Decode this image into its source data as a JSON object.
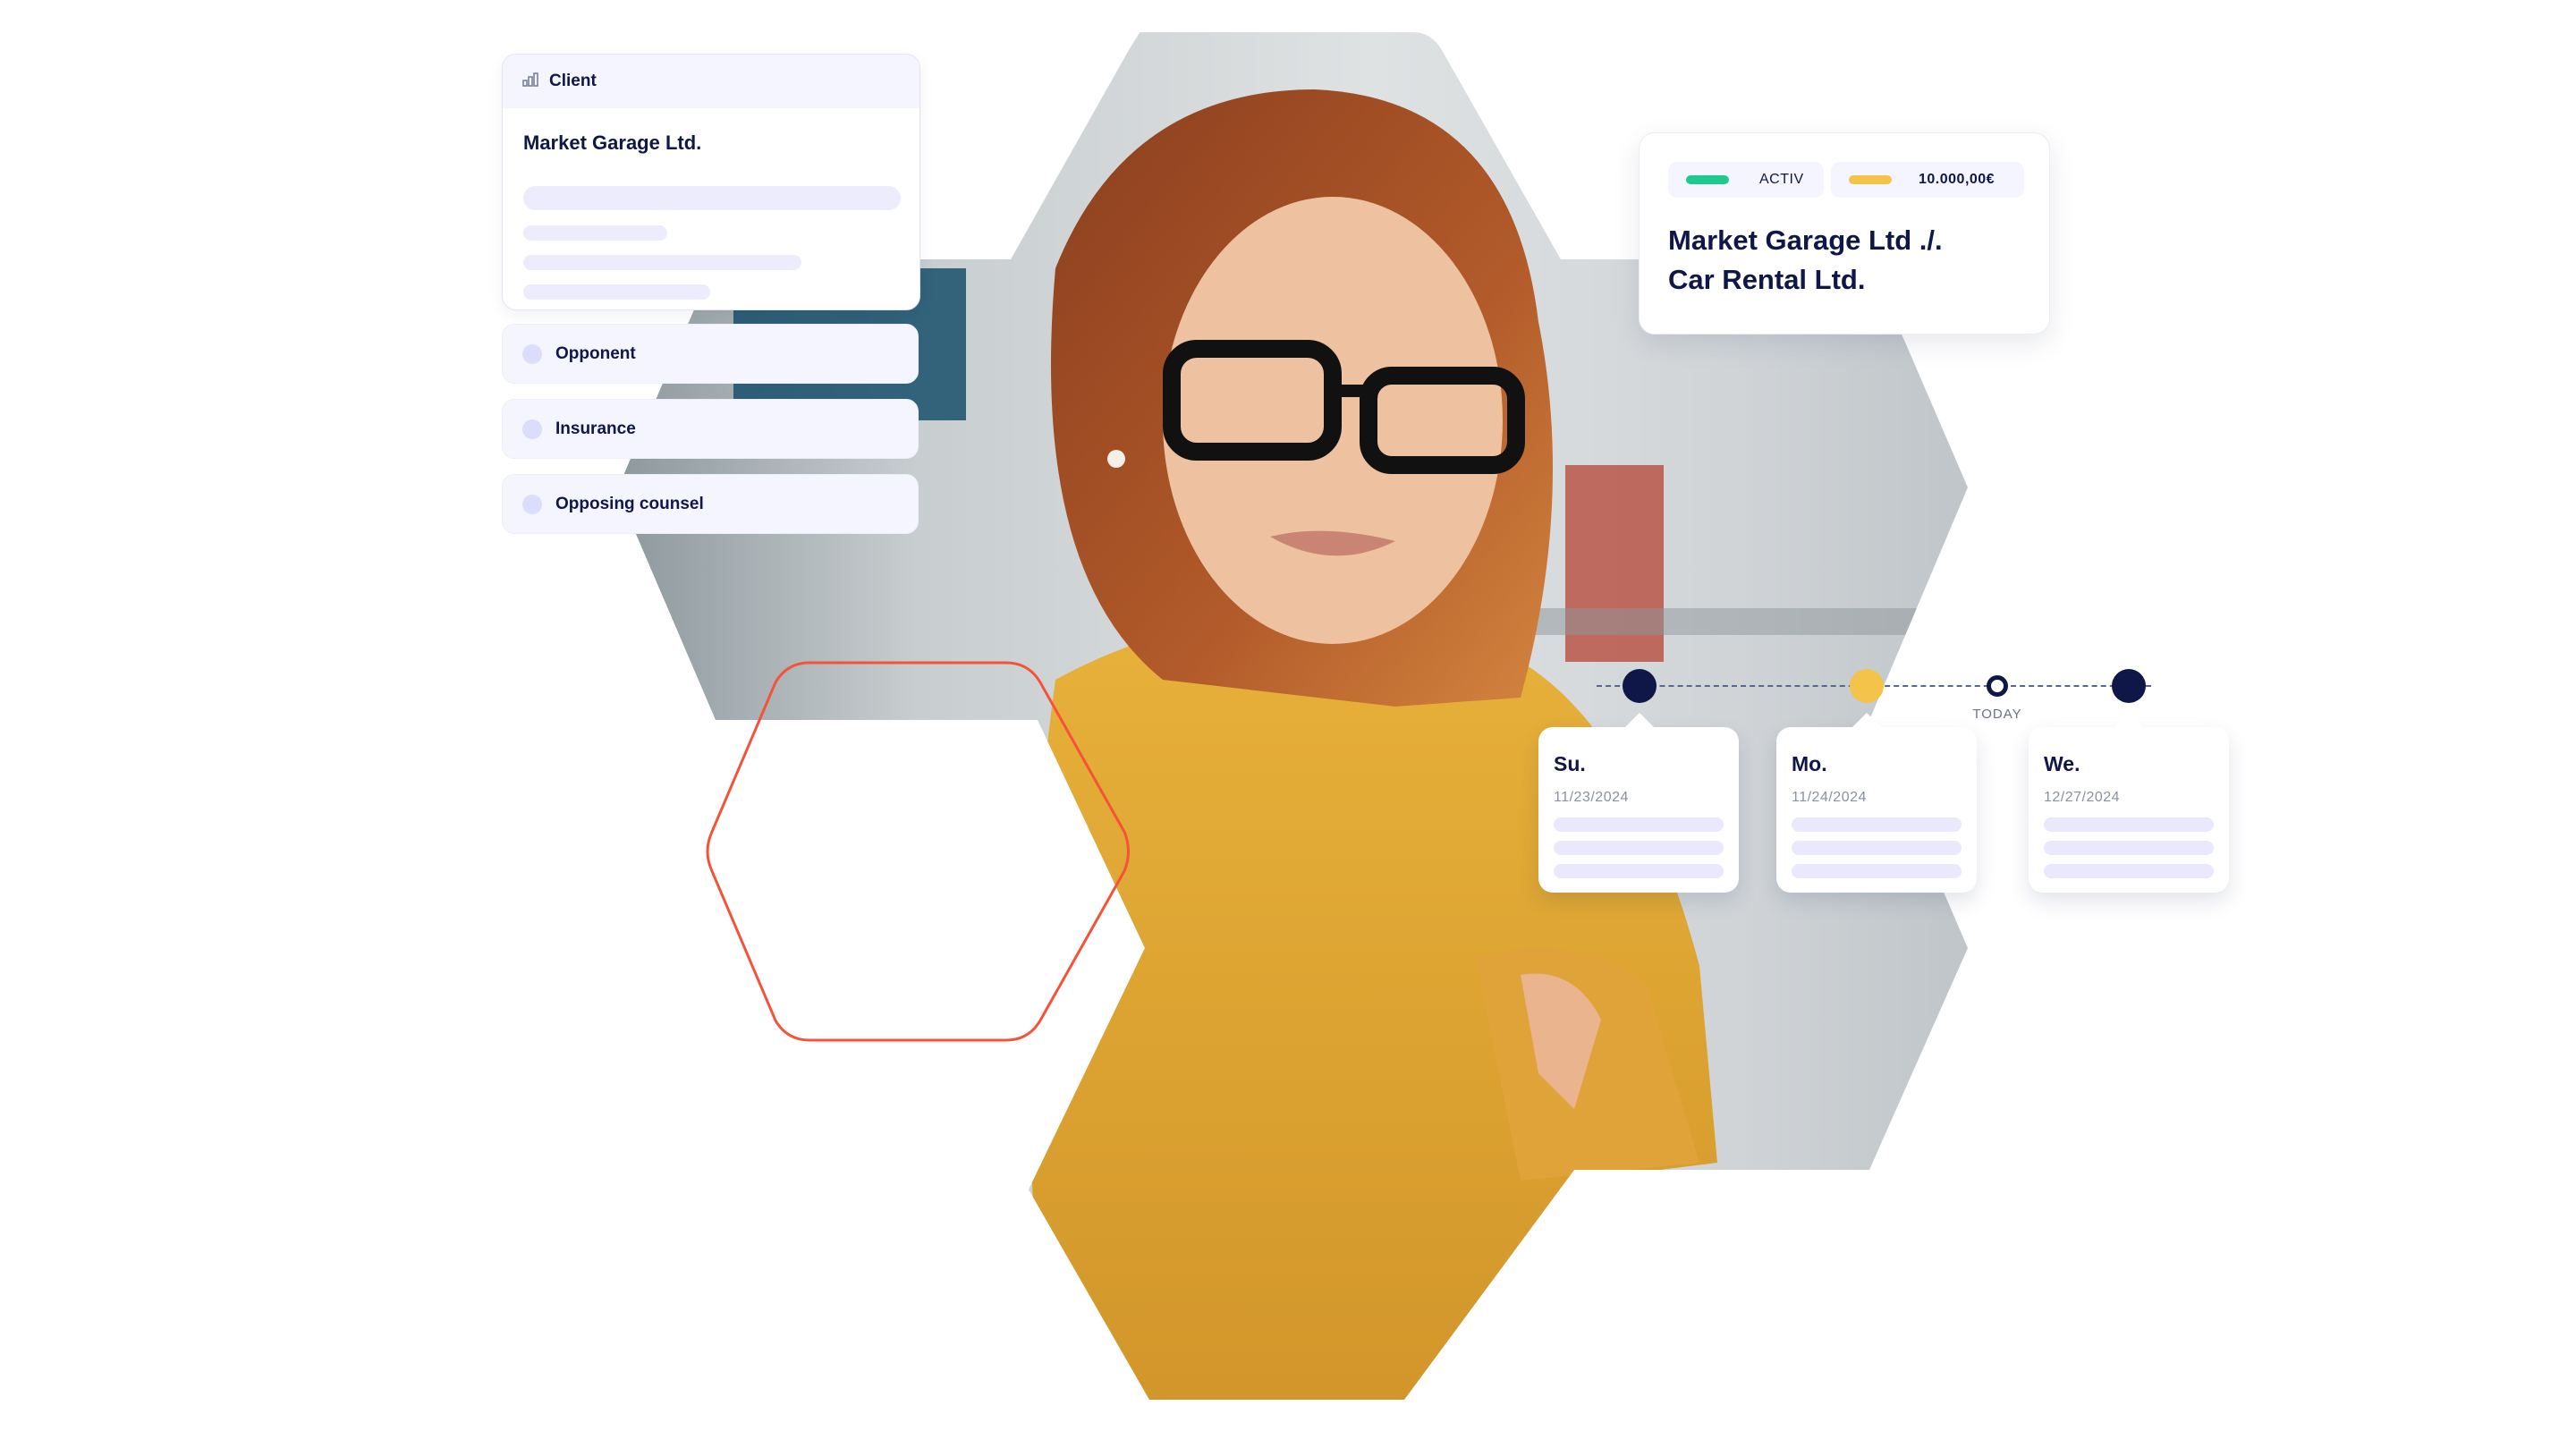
{
  "client_card": {
    "header_icon": "bar-chart-icon",
    "header_label": "Client",
    "name": "Market Garage Ltd."
  },
  "parties": [
    {
      "label": "Opponent"
    },
    {
      "label": "Insurance"
    },
    {
      "label": "Opposing counsel"
    }
  ],
  "case_card": {
    "status_label": "ACTIV",
    "status_color": "#1ecb8c",
    "amount_label": "10.000,00€",
    "amount_color": "#f3c34a",
    "title_line1": "Market Garage Ltd ./.",
    "title_line2": "Car Rental Ltd."
  },
  "timeline": {
    "today_label": "TODAY",
    "events": [
      {
        "day": "Su.",
        "date": "11/23/2024",
        "dot_color": "#0f1749"
      },
      {
        "day": "Mo.",
        "date": "11/24/2024",
        "dot_color": "#f3c34a"
      },
      {
        "day": "We.",
        "date": "12/27/2024",
        "dot_color": "#0f1749"
      }
    ]
  },
  "colors": {
    "navy": "#0f1749",
    "accent_orange": "#f4533a",
    "skeleton": "#ececfd",
    "panel": "#f4f5fe"
  }
}
